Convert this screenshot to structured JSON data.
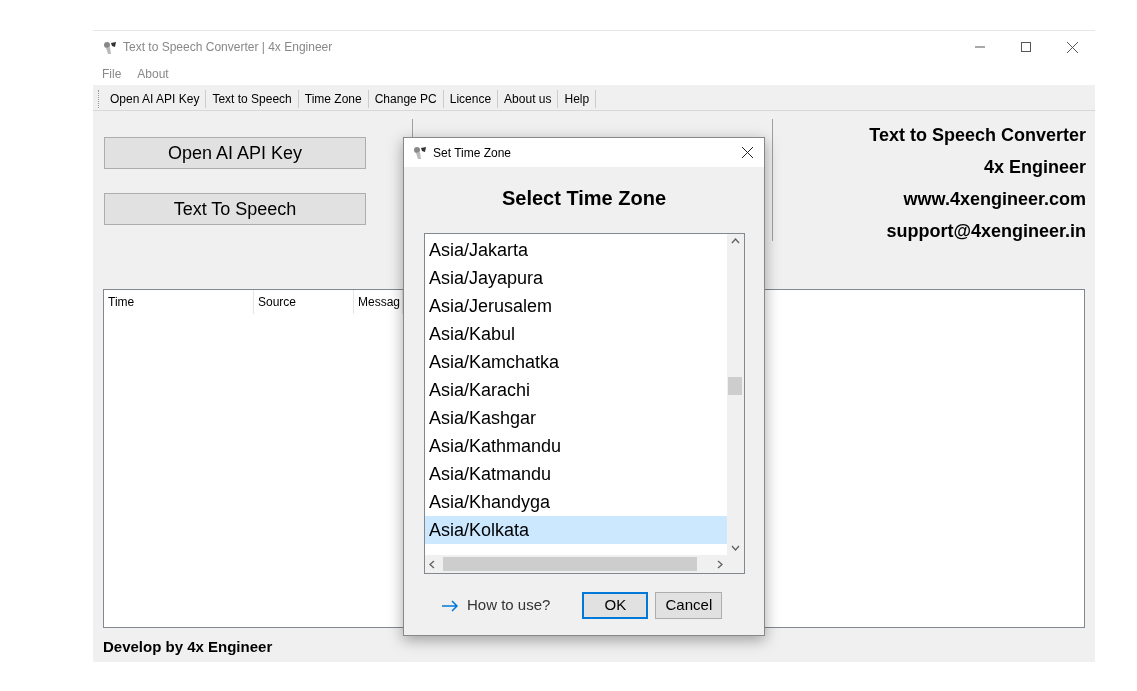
{
  "window": {
    "title": "Text to Speech Converter | 4x Engineer"
  },
  "menu": [
    "File",
    "About"
  ],
  "toolbar": [
    "Open AI API Key",
    "Text to Speech",
    "Time Zone",
    "Change PC",
    "Licence",
    "About us",
    "Help"
  ],
  "buttons": [
    "Open AI API Key",
    "Text To Speech"
  ],
  "info": [
    "Text to Speech Converter",
    "4x Engineer",
    "www.4xengineer.com",
    "support@4xengineer.in"
  ],
  "log": {
    "columns": [
      "Time",
      "Source",
      "Messag"
    ]
  },
  "footer": "Develop by 4x Engineer",
  "dialog": {
    "title": "Set Time Zone",
    "heading": "Select Time Zone",
    "items": [
      {
        "label": "Asia/Jakarta",
        "selected": false
      },
      {
        "label": "Asia/Jayapura",
        "selected": false
      },
      {
        "label": "Asia/Jerusalem",
        "selected": false
      },
      {
        "label": "Asia/Kabul",
        "selected": false
      },
      {
        "label": "Asia/Kamchatka",
        "selected": false
      },
      {
        "label": "Asia/Karachi",
        "selected": false
      },
      {
        "label": "Asia/Kashgar",
        "selected": false
      },
      {
        "label": "Asia/Kathmandu",
        "selected": false
      },
      {
        "label": "Asia/Katmandu",
        "selected": false
      },
      {
        "label": "Asia/Khandyga",
        "selected": false
      },
      {
        "label": "Asia/Kolkata",
        "selected": true
      }
    ],
    "help_link": "How to use?",
    "buttons": [
      {
        "label": "OK",
        "kind": "default"
      },
      {
        "label": "Cancel",
        "kind": "normal"
      }
    ]
  }
}
